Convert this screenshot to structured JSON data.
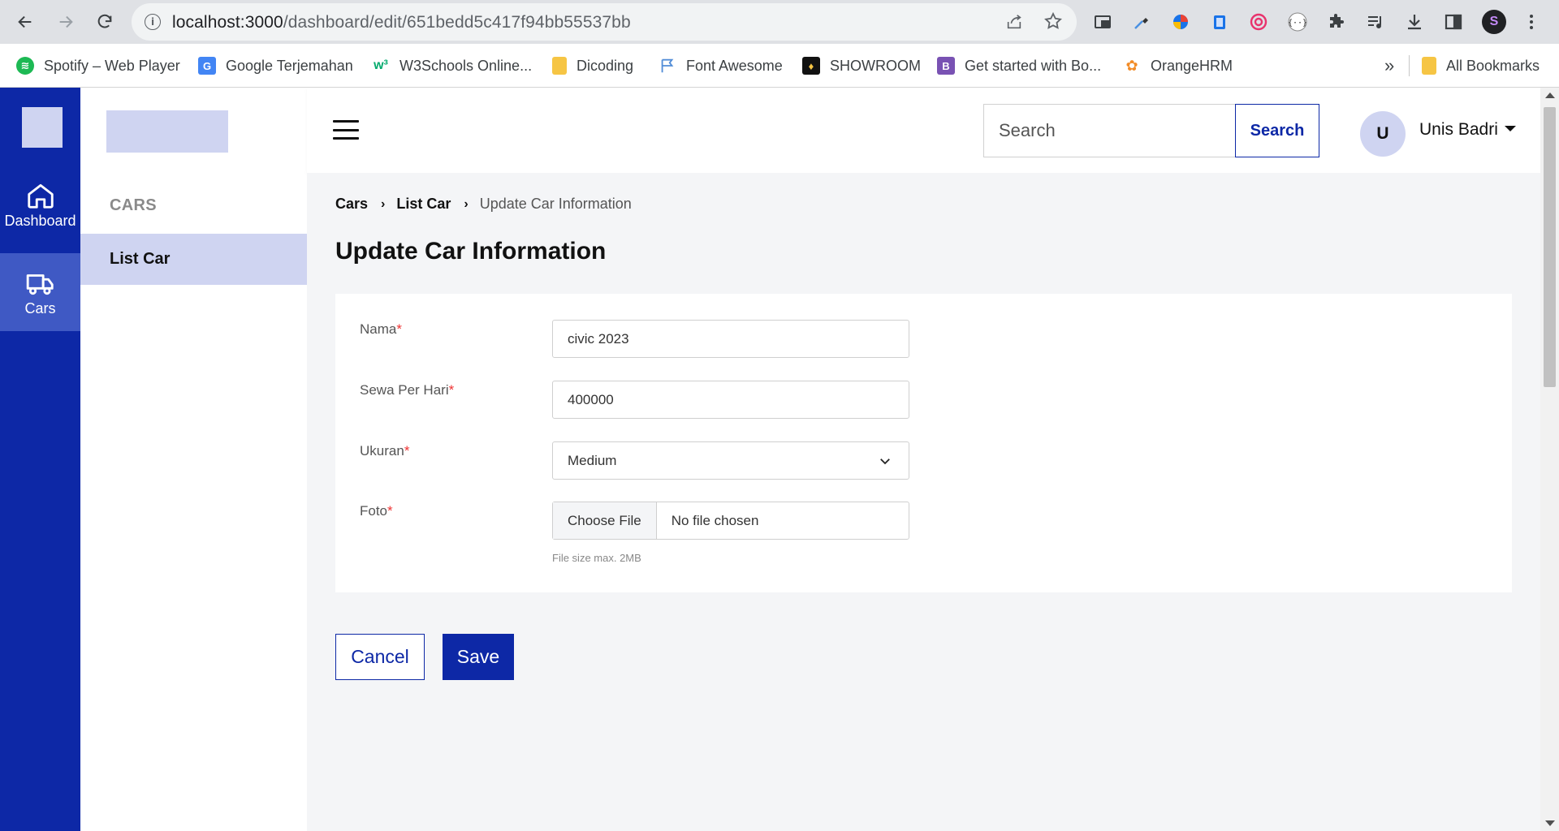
{
  "browser": {
    "url_host": "localhost:3000",
    "url_path": "/dashboard/edit/651bedd5c417f94bb55537bb",
    "bookmarks": [
      {
        "label": "Spotify – Web Player",
        "icon": "spotify-icon",
        "color": "#1db954"
      },
      {
        "label": "Google Terjemahan",
        "icon": "google-translate-icon",
        "color": "#4285f4"
      },
      {
        "label": "W3Schools Online...",
        "icon": "w3schools-icon",
        "color": "#04aa6d"
      },
      {
        "label": "Dicoding",
        "icon": "folder-icon",
        "color": "#f6c544"
      },
      {
        "label": "Font Awesome",
        "icon": "flag-icon",
        "color": "#528dd7"
      },
      {
        "label": "SHOWROOM",
        "icon": "showroom-icon",
        "color": "#111111"
      },
      {
        "label": "Get started with Bo...",
        "icon": "bootstrap-icon",
        "color": "#7952b3"
      },
      {
        "label": "OrangeHRM",
        "icon": "orangehrm-icon",
        "color": "#f28c28"
      }
    ],
    "more": "»",
    "all_bookmarks": "All Bookmarks",
    "profile_initial": "S"
  },
  "rail": {
    "items": [
      {
        "label": "Dashboard",
        "icon": "home-icon"
      },
      {
        "label": "Cars",
        "icon": "truck-icon"
      }
    ]
  },
  "sidebar": {
    "title": "CARS",
    "items": [
      {
        "label": "List Car"
      }
    ]
  },
  "topbar": {
    "search_placeholder": "Search",
    "search_button": "Search",
    "avatar_initial": "U",
    "user_name": "Unis Badri"
  },
  "breadcrumb": [
    "Cars",
    "List Car",
    "Update Car Information"
  ],
  "page_title": "Update Car Information",
  "form": {
    "name_label": "Nama",
    "name_value": "civic 2023",
    "price_label": "Sewa Per Hari",
    "price_value": "400000",
    "size_label": "Ukuran",
    "size_value": "Medium",
    "photo_label": "Foto",
    "photo_button": "Choose File",
    "photo_status": "No file chosen",
    "photo_hint": "File size max. 2MB",
    "required_marker": "*"
  },
  "actions": {
    "cancel": "Cancel",
    "save": "Save"
  },
  "colors": {
    "primary": "#0d28a6",
    "active_rail": "#3f59c4",
    "light_accent": "#cfd4f1",
    "required": "#ee3333"
  }
}
